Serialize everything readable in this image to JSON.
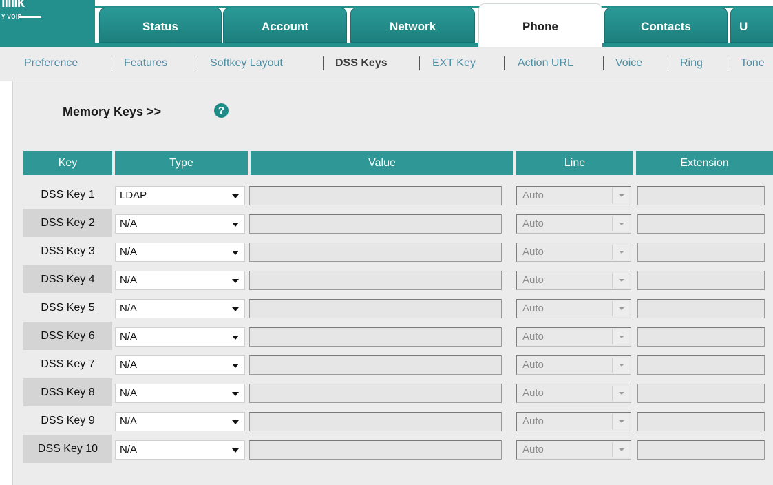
{
  "brand": {
    "logo": "ililik",
    "sub": "Y VOIP"
  },
  "tabs": [
    {
      "label": "Status",
      "active": false
    },
    {
      "label": "Account",
      "active": false
    },
    {
      "label": "Network",
      "active": false
    },
    {
      "label": "Phone",
      "active": true
    },
    {
      "label": "Contacts",
      "active": false
    },
    {
      "label": "U",
      "active": false
    }
  ],
  "subnav": [
    {
      "label": "Preference",
      "active": false
    },
    {
      "label": "Features",
      "active": false
    },
    {
      "label": "Softkey Layout",
      "active": false
    },
    {
      "label": "DSS Keys",
      "active": true
    },
    {
      "label": "EXT Key",
      "active": false
    },
    {
      "label": "Action URL",
      "active": false
    },
    {
      "label": "Voice",
      "active": false
    },
    {
      "label": "Ring",
      "active": false
    },
    {
      "label": "Tone",
      "active": false
    }
  ],
  "section": {
    "title": "Memory Keys >>",
    "help": "?"
  },
  "table": {
    "headers": {
      "key": "Key",
      "type": "Type",
      "value": "Value",
      "line": "Line",
      "extension": "Extension"
    },
    "rows": [
      {
        "key": "DSS Key 1",
        "type": "LDAP",
        "value": "",
        "line": "Auto",
        "extension": ""
      },
      {
        "key": "DSS Key 2",
        "type": "N/A",
        "value": "",
        "line": "Auto",
        "extension": ""
      },
      {
        "key": "DSS Key 3",
        "type": "N/A",
        "value": "",
        "line": "Auto",
        "extension": ""
      },
      {
        "key": "DSS Key 4",
        "type": "N/A",
        "value": "",
        "line": "Auto",
        "extension": ""
      },
      {
        "key": "DSS Key 5",
        "type": "N/A",
        "value": "",
        "line": "Auto",
        "extension": ""
      },
      {
        "key": "DSS Key 6",
        "type": "N/A",
        "value": "",
        "line": "Auto",
        "extension": ""
      },
      {
        "key": "DSS Key 7",
        "type": "N/A",
        "value": "",
        "line": "Auto",
        "extension": ""
      },
      {
        "key": "DSS Key 8",
        "type": "N/A",
        "value": "",
        "line": "Auto",
        "extension": ""
      },
      {
        "key": "DSS Key 9",
        "type": "N/A",
        "value": "",
        "line": "Auto",
        "extension": ""
      },
      {
        "key": "DSS Key 10",
        "type": "N/A",
        "value": "",
        "line": "Auto",
        "extension": ""
      }
    ]
  },
  "colors": {
    "accent": "#23908e",
    "header_cell": "#2f9896",
    "link": "#4d8ea1",
    "shaded_row": "#d4d4d4"
  }
}
